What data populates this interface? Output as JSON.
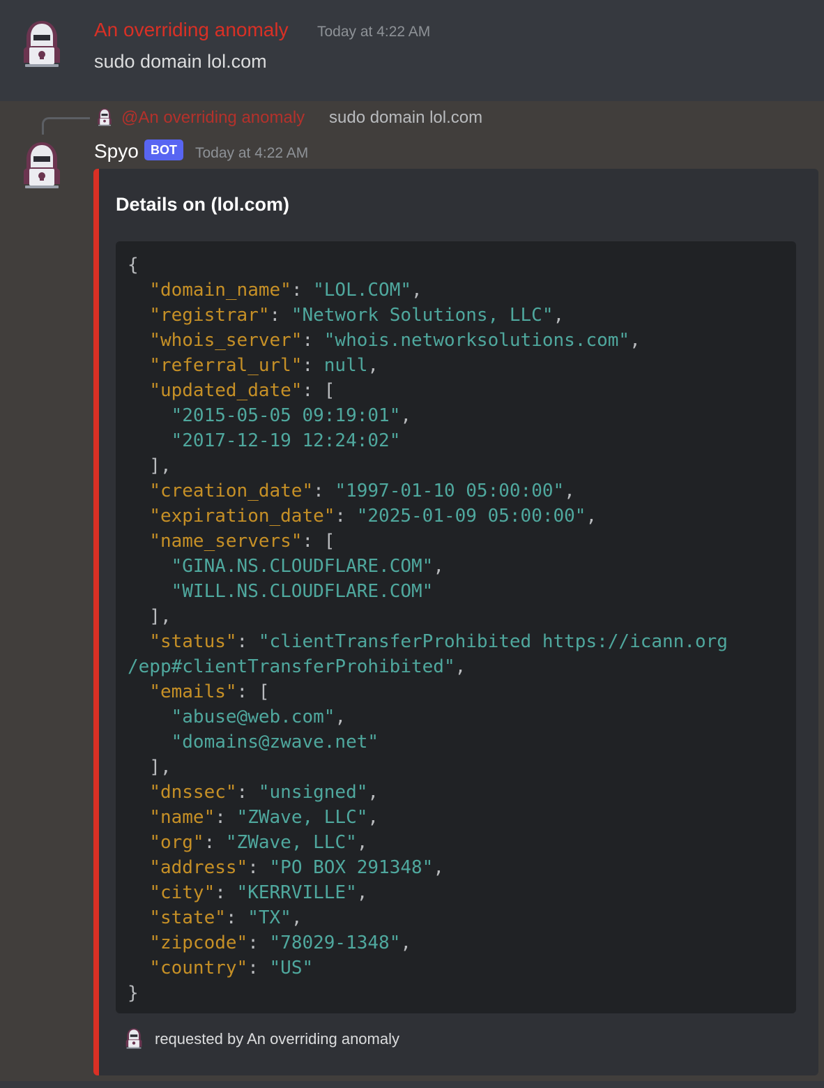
{
  "colors": {
    "user_name": "#d93025",
    "mention": "#b4312b",
    "bot_tag": "#5865f2",
    "embed_accent": "#d93025",
    "json_key": "#c69026",
    "json_string": "#4fa89e"
  },
  "message1": {
    "author": "An overriding anomaly",
    "timestamp": "Today at 4:22 AM",
    "content": "sudo domain lol.com",
    "avatar_icon": "hacker-skull-laptop-icon"
  },
  "message2": {
    "reply": {
      "mention": "@An overriding anomaly",
      "text": "sudo domain lol.com"
    },
    "author": "Spyo",
    "bot_tag": "BOT",
    "timestamp": "Today at 4:22 AM",
    "avatar_icon": "hacker-skull-laptop-icon",
    "embed": {
      "title": "Details on (lol.com)",
      "code": {
        "open_brace": "{",
        "close_brace": "}",
        "domain_name_key": "\"domain_name\"",
        "domain_name_value": "\"LOL.COM\"",
        "registrar_key": "\"registrar\"",
        "registrar_value": "\"Network Solutions, LLC\"",
        "whois_server_key": "\"whois_server\"",
        "whois_server_value": "\"whois.networksolutions.com\"",
        "referral_url_key": "\"referral_url\"",
        "referral_url_value": "null",
        "updated_date_key": "\"updated_date\"",
        "updated_date_values": [
          "\"2015-05-05 09:19:01\"",
          "\"2017-12-19 12:24:02\""
        ],
        "creation_date_key": "\"creation_date\"",
        "creation_date_value": "\"1997-01-10 05:00:00\"",
        "expiration_date_key": "\"expiration_date\"",
        "expiration_date_value": "\"2025-01-09 05:00:00\"",
        "name_servers_key": "\"name_servers\"",
        "name_servers_values": [
          "\"GINA.NS.CLOUDFLARE.COM\"",
          "\"WILL.NS.CLOUDFLARE.COM\""
        ],
        "status_key": "\"status\"",
        "status_value_line1": "\"clientTransferProhibited https://icann.org",
        "status_value_line2": "/epp#clientTransferProhibited\"",
        "emails_key": "\"emails\"",
        "emails_values": [
          "\"abuse@web.com\"",
          "\"domains@zwave.net\""
        ],
        "dnssec_key": "\"dnssec\"",
        "dnssec_value": "\"unsigned\"",
        "name_key": "\"name\"",
        "name_value": "\"ZWave, LLC\"",
        "org_key": "\"org\"",
        "org_value": "\"ZWave, LLC\"",
        "address_key": "\"address\"",
        "address_value": "\"PO BOX 291348\"",
        "city_key": "\"city\"",
        "city_value": "\"KERRVILLE\"",
        "state_key": "\"state\"",
        "state_value": "\"TX\"",
        "zipcode_key": "\"zipcode\"",
        "zipcode_value": "\"78029-1348\"",
        "country_key": "\"country\"",
        "country_value": "\"US\""
      },
      "footer": "requested by An overriding anomaly"
    }
  }
}
